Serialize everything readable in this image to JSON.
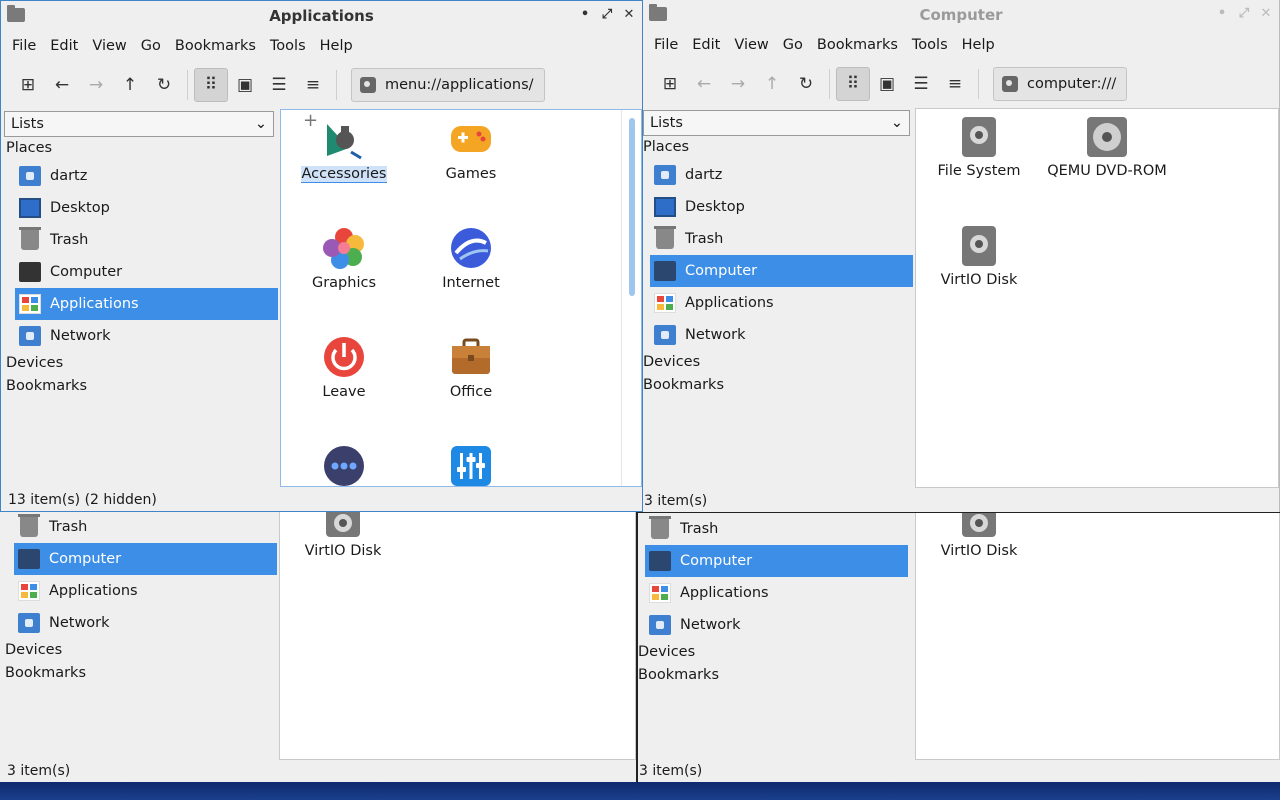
{
  "menu": [
    "File",
    "Edit",
    "View",
    "Go",
    "Bookmarks",
    "Tools",
    "Help"
  ],
  "colors": {
    "selection": "#3d8ee6",
    "accent_border": "#3d85c6"
  },
  "side_combo": "Lists",
  "sections": {
    "places": "Places",
    "devices": "Devices",
    "bookmarks": "Bookmarks"
  },
  "places": [
    "dartz",
    "Desktop",
    "Trash",
    "Computer",
    "Applications",
    "Network"
  ],
  "win_apps": {
    "title": "Applications",
    "location": "menu://applications/",
    "status": "13 item(s) (2 hidden)",
    "items": [
      "Accessories",
      "Games",
      "Graphics",
      "Internet",
      "Leave",
      "Office"
    ]
  },
  "win_computer": {
    "title": "Computer",
    "location": "computer:///",
    "status": "3 item(s)",
    "items": [
      "File System",
      "QEMU DVD-ROM",
      "VirtIO Disk"
    ]
  },
  "win_bottom_left": {
    "status": "3 item(s)",
    "item": "VirtIO Disk"
  },
  "win_bottom_right": {
    "status": "3 item(s)",
    "item": "VirtIO Disk"
  }
}
